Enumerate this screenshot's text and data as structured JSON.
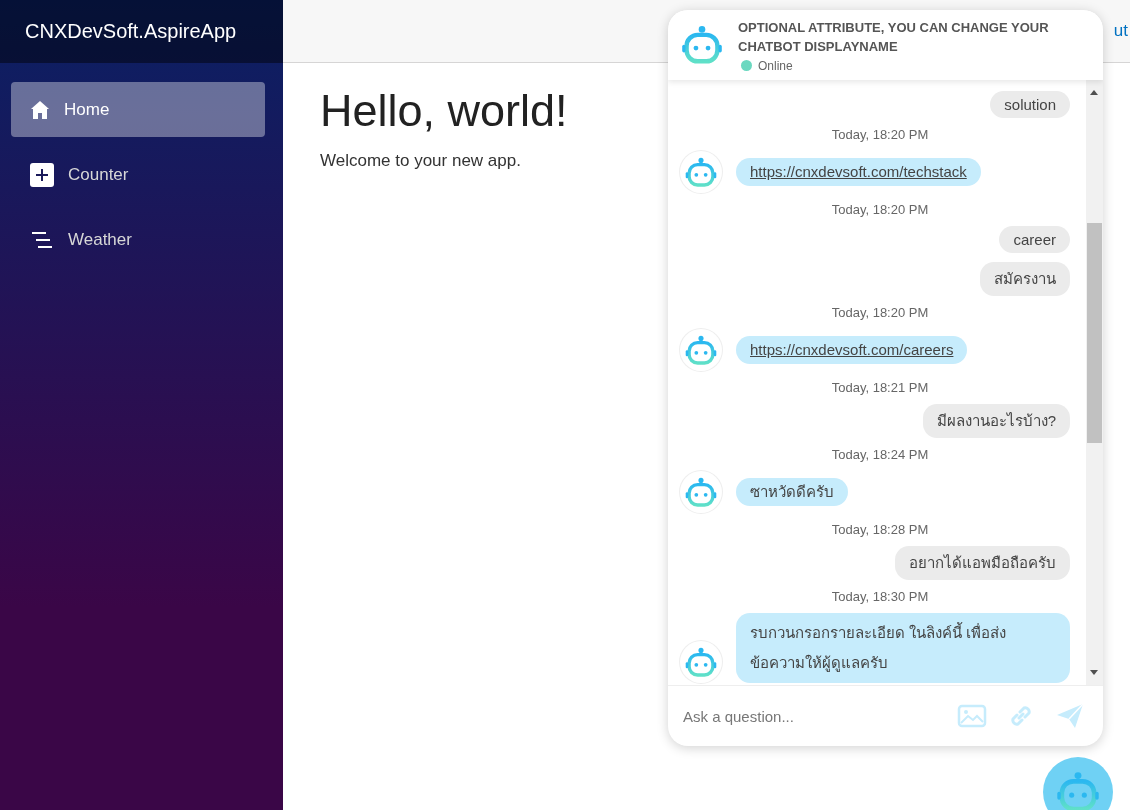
{
  "sidebar": {
    "brand": "CNXDevSoft.AspireApp",
    "items": [
      {
        "label": "Home",
        "selected": true
      },
      {
        "label": "Counter",
        "selected": false
      },
      {
        "label": "Weather",
        "selected": false
      }
    ]
  },
  "top_bar": {
    "link": "ut"
  },
  "main": {
    "heading": "Hello, world!",
    "text": "Welcome to your new app."
  },
  "chat": {
    "title": "OPTIONAL ATTRIBUTE, YOU CAN CHANGE YOUR CHATBOT DISPLAYNAME",
    "status": "Online",
    "online": true,
    "messages": [
      {
        "kind": "user",
        "text": "solution"
      },
      {
        "kind": "time",
        "text": "Today, 18:20 PM"
      },
      {
        "kind": "bot",
        "text": "https://cnxdevsoft.com/techstack",
        "link": true
      },
      {
        "kind": "time",
        "text": "Today, 18:20 PM"
      },
      {
        "kind": "user",
        "text": "career"
      },
      {
        "kind": "user",
        "text": "สมัครงาน"
      },
      {
        "kind": "time",
        "text": "Today, 18:20 PM"
      },
      {
        "kind": "bot",
        "text": "https://cnxdevsoft.com/careers",
        "link": true
      },
      {
        "kind": "time",
        "text": "Today, 18:21 PM"
      },
      {
        "kind": "user",
        "text": "มีผลงานอะไรบ้าง?"
      },
      {
        "kind": "time",
        "text": "Today, 18:24 PM"
      },
      {
        "kind": "bot",
        "text": "ซาหวัดดีครับ",
        "link": false
      },
      {
        "kind": "time",
        "text": "Today, 18:28 PM"
      },
      {
        "kind": "user",
        "text": "อยากได้แอพมือถือครับ"
      },
      {
        "kind": "time",
        "text": "Today, 18:30 PM"
      },
      {
        "kind": "bot",
        "text": "รบกวนกรอกรายละเอียด ในลิงค์นี้ เพื่อส่งข้อความให้ผู้ดูแลครับ",
        "link": false
      }
    ],
    "input": {
      "placeholder": "Ask a question..."
    }
  }
}
